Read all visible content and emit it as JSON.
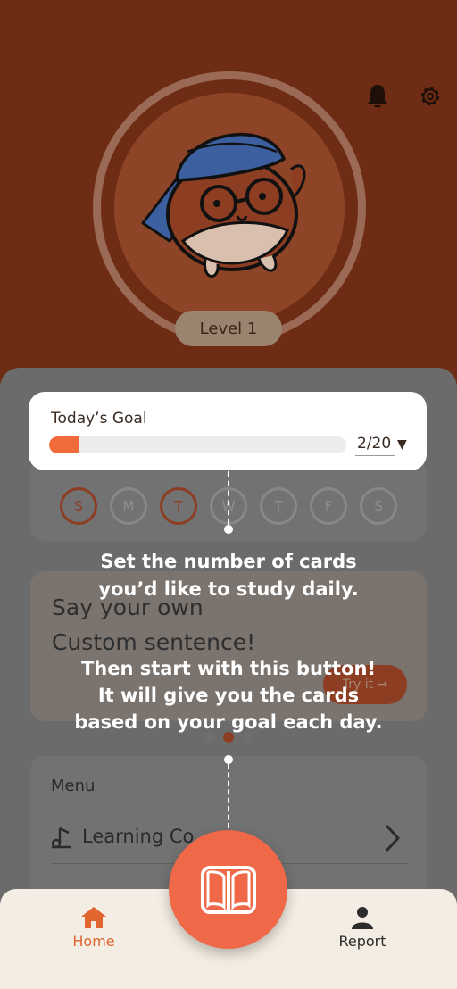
{
  "header": {
    "level_label": "Level 1",
    "icons": [
      "bell-icon",
      "gear-icon"
    ],
    "colors": {
      "background": "#6e2c14",
      "ring": "#9a6a56"
    }
  },
  "goal": {
    "title": "Today’s Goal",
    "progress_count": "2/20",
    "progress_fraction": 0.1,
    "dropdown_caret": "▼"
  },
  "week": {
    "days": [
      {
        "label": "S",
        "active": true
      },
      {
        "label": "M",
        "active": false
      },
      {
        "label": "T",
        "active": true
      },
      {
        "label": "W",
        "active": false
      },
      {
        "label": "T",
        "active": false
      },
      {
        "label": "F",
        "active": false
      },
      {
        "label": "S",
        "active": false
      }
    ]
  },
  "sentence_card": {
    "line1": "Say your own",
    "line2": "Custom sentence!",
    "button_label": "Try it →"
  },
  "tips": {
    "tip1_line1": "Set the number of cards",
    "tip1_line2": "you’d like to study daily.",
    "tip2_line1": "Then start with this button!",
    "tip2_line2": "It will give you the cards",
    "tip2_line3": "based on your goal each day."
  },
  "menu": {
    "title": "Menu",
    "item1_label": "Learning Co"
  },
  "bottom_nav": {
    "home_label": "Home",
    "report_label": "Report",
    "accent": "#e0652f",
    "fab_color": "#ef6848"
  }
}
